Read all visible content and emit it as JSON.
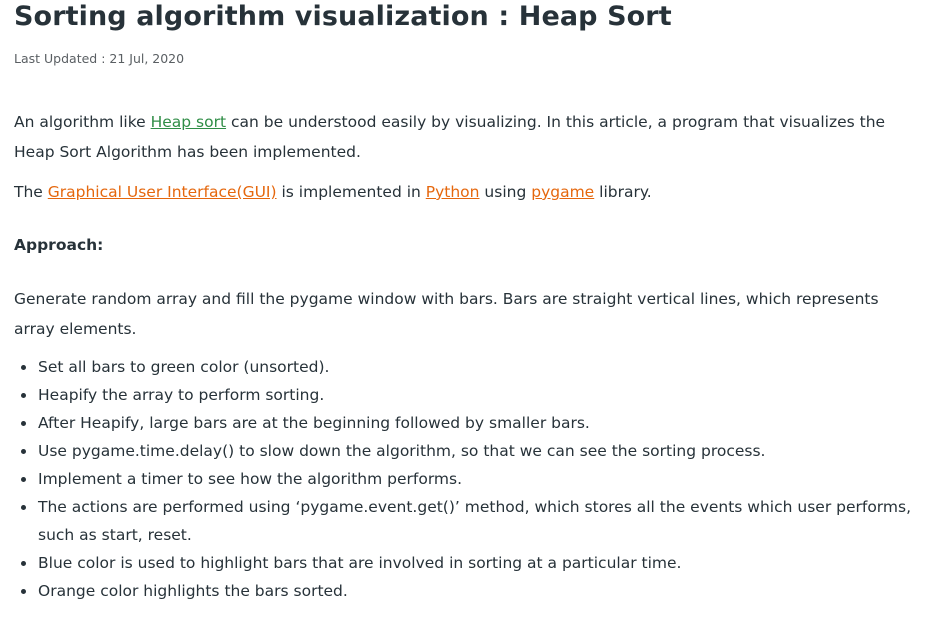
{
  "article": {
    "title": "Sorting algorithm visualization : Heap Sort",
    "last_updated": "Last Updated : 21 Jul, 2020",
    "intro": {
      "before_link": "An algorithm like ",
      "link_text": "Heap sort",
      "after_link": " can be understood easily by visualizing. In this article, a program that visualizes the Heap Sort Algorithm has been implemented."
    },
    "gui_line": {
      "part1": "The ",
      "gui_link": "Graphical User Interface(GUI)",
      "part2": " is implemented in ",
      "python_link": "Python",
      "part3": " using ",
      "pygame_link": "pygame",
      "part4": " library."
    },
    "approach_heading": "Approach:",
    "approach_text": "Generate random array and fill the pygame window with bars. Bars are straight vertical lines, which represents array elements.",
    "steps": [
      "Set all bars to green color (unsorted).",
      "Heapify the array to perform sorting.",
      "After Heapify, large bars are at the beginning followed by smaller bars.",
      "Use pygame.time.delay() to slow down the algorithm, so that we can see the sorting process.",
      "Implement a timer to see how the algorithm performs.",
      "The actions are performed using ‘pygame.event.get()’ method, which stores all the events which user performs, such as start, reset.",
      "Blue color is used to highlight bars that are involved in sorting at a particular time.",
      "Orange color highlights the bars sorted."
    ]
  },
  "colors": {
    "text": "#273239",
    "link_green": "#2f8d46",
    "link_orange": "#e5670d",
    "meta": "#5a5f63"
  }
}
